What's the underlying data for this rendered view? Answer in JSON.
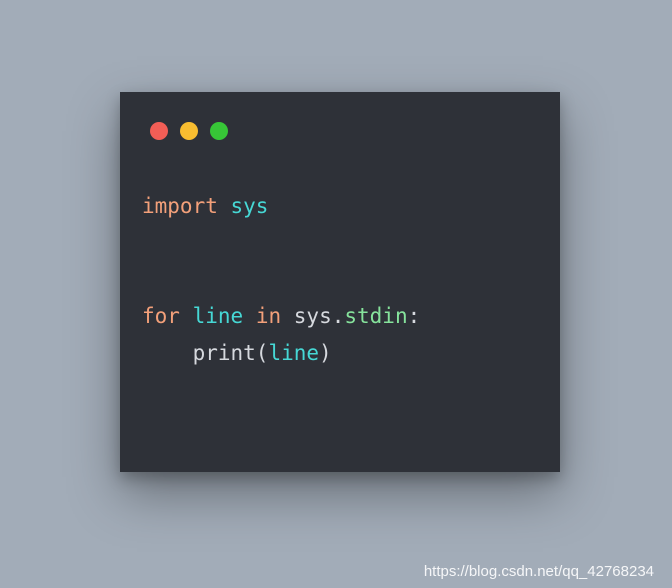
{
  "window": {
    "traffic_lights": {
      "red": "#f25e56",
      "yellow": "#f8bd30",
      "green": "#37c637"
    }
  },
  "code": {
    "line1": {
      "import": "import",
      "sp1": " ",
      "module": "sys"
    },
    "blank": "",
    "line2": {
      "for": "for",
      "sp1": " ",
      "var": "line",
      "sp2": " ",
      "in": "in",
      "sp3": " ",
      "obj": "sys",
      "dot": ".",
      "attr": "stdin",
      "colon": ":"
    },
    "line3": {
      "indent": "    ",
      "func": "print",
      "lparen": "(",
      "arg": "line",
      "rparen": ")"
    }
  },
  "watermark": "https://blog.csdn.net/qq_42768234"
}
